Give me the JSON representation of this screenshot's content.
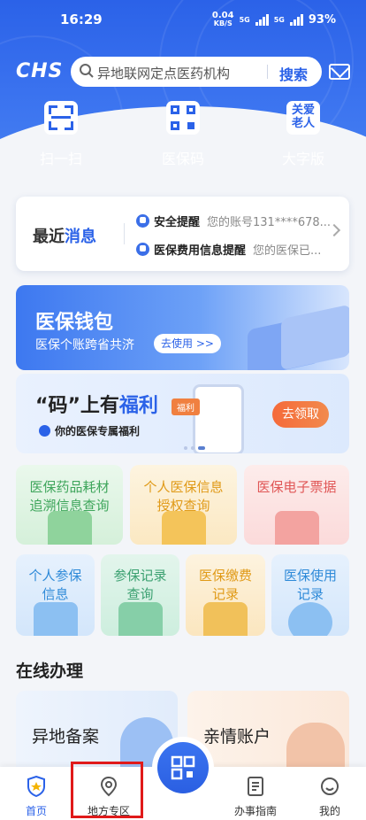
{
  "status_bar": {
    "time": "16:29",
    "net_speed": "0.04",
    "net_unit": "KB/S",
    "sim1": "5G",
    "sim2": "5G",
    "battery": "93%"
  },
  "header": {
    "logo": "CHS",
    "search_placeholder": "异地联网定点医药机构",
    "search_button": "搜索"
  },
  "quick_actions": [
    {
      "label": "扫一扫",
      "icon": "scan-icon"
    },
    {
      "label": "医保码",
      "icon": "qr-code-icon"
    },
    {
      "label": "大字版",
      "icon": "elder-care-icon",
      "icon_text": "关爱老人"
    }
  ],
  "messages": {
    "title_a": "最近",
    "title_b": "消息",
    "items": [
      {
        "title": "安全提醒",
        "preview": "您的账号131****678..."
      },
      {
        "title": "医保费用信息提醒",
        "preview": "您的医保已..."
      }
    ]
  },
  "banners": {
    "wallet": {
      "title": "医保钱包",
      "subtitle": "医保个账跨省共济",
      "button": "去使用 >>"
    },
    "welfare": {
      "title_a": "“码”上有",
      "title_b": "福利",
      "subtitle": "你的医保专属福利",
      "tag": "福利",
      "button": "去领取"
    }
  },
  "services_row1": [
    {
      "label": "医保药品耗材追溯信息查询",
      "color": "#4fb36a"
    },
    {
      "label": "个人医保信息授权查询",
      "color": "#e6a21d"
    },
    {
      "label": "医保电子票据",
      "color": "#e35b5b"
    }
  ],
  "services_row2": [
    {
      "label": "个人参保信息",
      "color": "#2e8ad8"
    },
    {
      "label": "参保记录查询",
      "color": "#3aa070"
    },
    {
      "label": "医保缴费记录",
      "color": "#e6a21d"
    },
    {
      "label": "医保使用记录",
      "color": "#2e8ad8"
    }
  ],
  "online": {
    "title": "在线办理",
    "cards": [
      {
        "label": "异地备案"
      },
      {
        "label": "亲情账户"
      }
    ]
  },
  "tabbar": [
    {
      "label": "首页",
      "active": true
    },
    {
      "label": "地方专区",
      "highlighted": true
    },
    {
      "label": "办事指南"
    },
    {
      "label": "我的"
    }
  ],
  "colors": {
    "primary": "#2b62e8",
    "highlight_box": "#e01a1a"
  }
}
